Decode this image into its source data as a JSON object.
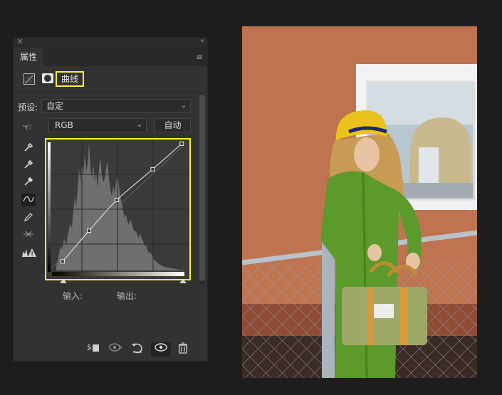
{
  "panel": {
    "close_glyph": "×",
    "collapse_glyph": "«",
    "tab_label": "属性",
    "menu_glyph": "≡",
    "title": "曲线",
    "preset_label": "预设:",
    "preset_value": "自定",
    "channel_value": "RGB",
    "auto_label": "自动",
    "chevron": "⌄",
    "input_label": "输入:",
    "output_label": "输出:"
  },
  "tools": [
    {
      "name": "sample-black-point-eyedropper-icon"
    },
    {
      "name": "sample-gray-point-eyedropper-icon"
    },
    {
      "name": "sample-white-point-eyedropper-icon"
    },
    {
      "name": "edit-points-curve-icon",
      "active": true
    },
    {
      "name": "pencil-draw-icon"
    },
    {
      "name": "smooth-curve-icon"
    },
    {
      "name": "clipping-warning-icon"
    }
  ],
  "footer_icons": [
    "clip-to-layer-icon",
    "view-previous-state-icon",
    "reset-icon",
    "visibility-eye-icon",
    "trash-icon"
  ],
  "curve": {
    "points": [
      [
        0.08,
        0.07
      ],
      [
        0.28,
        0.31
      ],
      [
        0.49,
        0.55
      ],
      [
        0.76,
        0.79
      ],
      [
        0.98,
        0.99
      ]
    ]
  },
  "colors": {
    "highlight": "#ffef39",
    "wall": "#bd6f4e",
    "coat": "#5c9a2c",
    "hat": "#e9c21c",
    "hair": "#c79b54"
  }
}
